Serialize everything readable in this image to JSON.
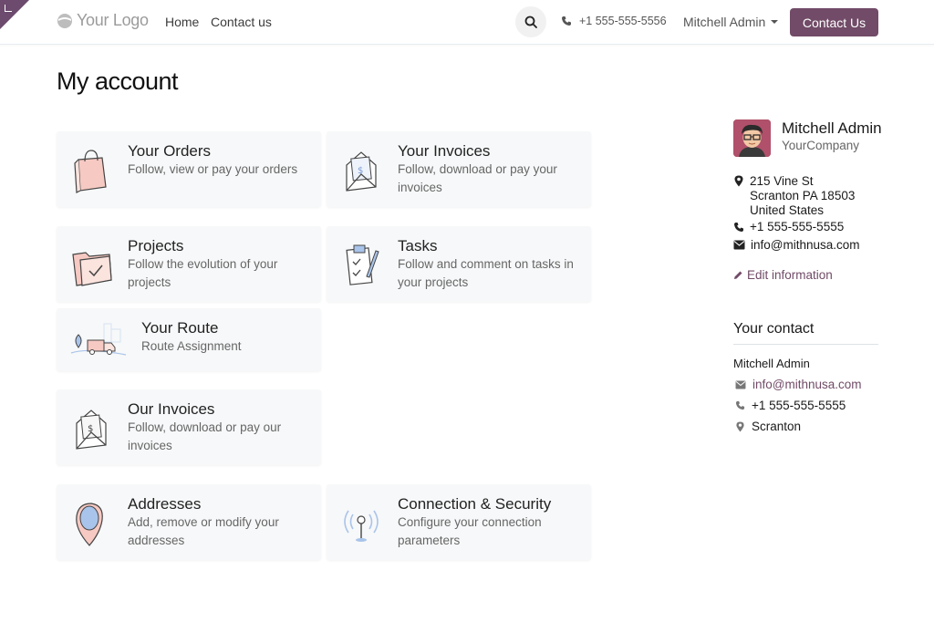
{
  "header": {
    "logo_text": "Your Logo",
    "nav": [
      "Home",
      "Contact us"
    ],
    "phone": "+1 555-555-5556",
    "user": "Mitchell Admin",
    "cta": "Contact Us"
  },
  "page_title": "My account",
  "cards": [
    {
      "title": "Your Orders",
      "desc1": "Follow, view or pay your orders",
      "desc2": "",
      "icon": "shopping-bag-icon"
    },
    {
      "title": "Your Invoices",
      "desc1": "Follow, download or pay your",
      "desc2": "invoices",
      "icon": "invoice-envelope-icon"
    },
    {
      "title": "Projects",
      "desc1": "Follow the evolution of your",
      "desc2": "projects",
      "icon": "folder-check-icon"
    },
    {
      "title": "Tasks",
      "desc1": "Follow and comment on tasks in",
      "desc2": "your projects",
      "icon": "clipboard-check-icon"
    },
    {
      "title": "Your Route",
      "desc1": "Route Assignment",
      "desc2": "",
      "icon": "delivery-truck-icon"
    },
    {
      "title": "Our Invoices",
      "desc1": "Follow, download or pay our",
      "desc2": "invoices",
      "icon": "invoice-envelope-icon"
    },
    {
      "title": "Addresses",
      "desc1": "Add, remove or modify your",
      "desc2": "addresses",
      "icon": "map-pin-icon"
    },
    {
      "title": "Connection & Security",
      "desc1": "Configure your connection",
      "desc2": "parameters",
      "icon": "antenna-icon"
    }
  ],
  "profile": {
    "name": "Mitchell Admin",
    "company": "YourCompany",
    "address_line1": "215 Vine St",
    "address_line2": "Scranton PA 18503",
    "address_line3": "United States",
    "phone": "+1 555-555-5555",
    "email": "info@mithnusa.com",
    "edit_label": "Edit information"
  },
  "your_contact": {
    "title": "Your contact",
    "name": "Mitchell Admin",
    "email": "info@mithnusa.com",
    "phone": "+1 555-555-5555",
    "city": "Scranton"
  },
  "colors": {
    "brand": "#714b67",
    "card_bg": "#f7f8f9",
    "icon_pink": "#f6c9c2",
    "icon_blue": "#a9c4ea"
  }
}
